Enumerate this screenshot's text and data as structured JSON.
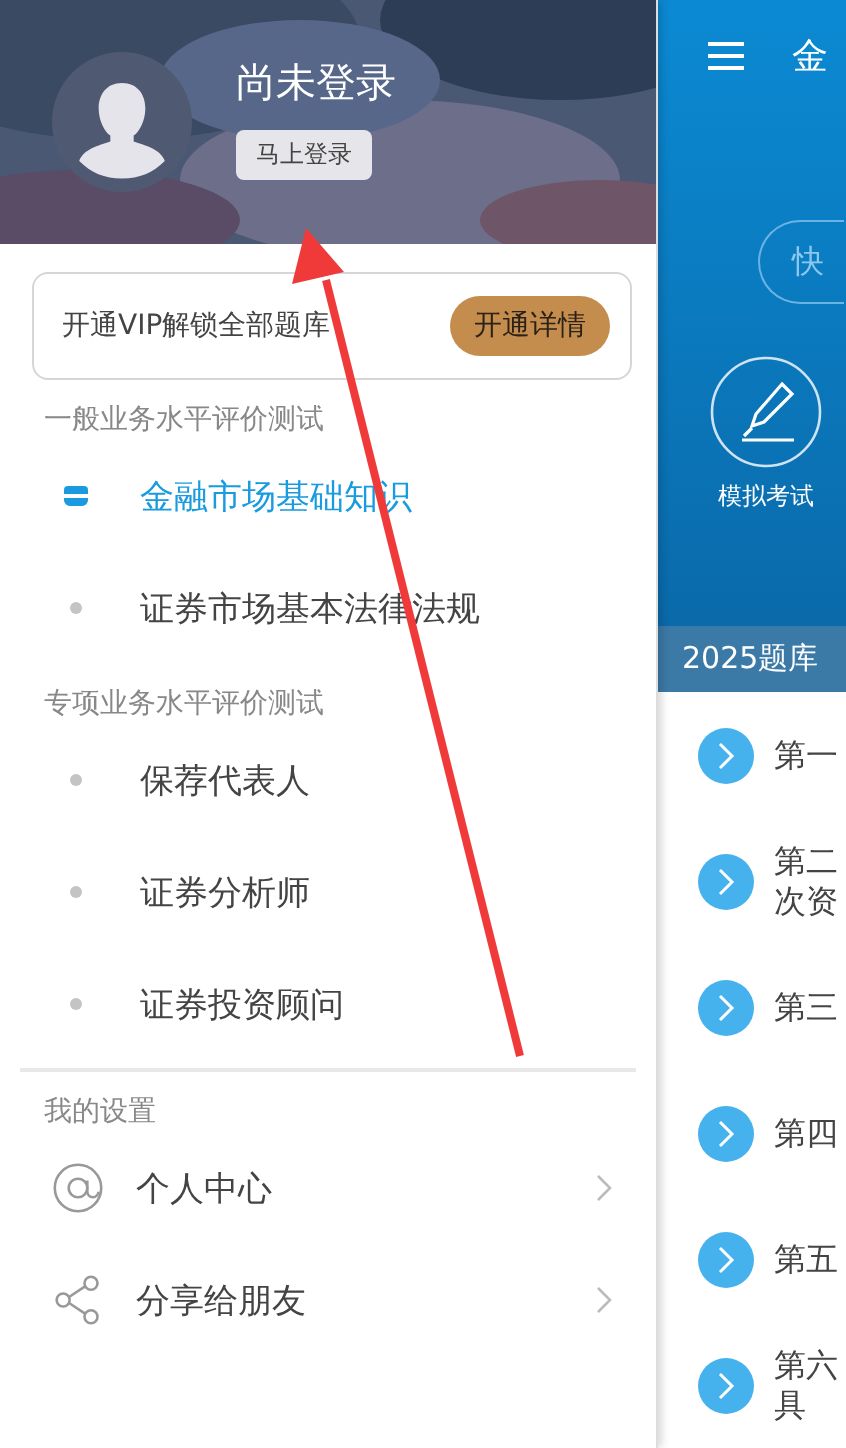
{
  "drawer": {
    "header": {
      "title": "尚未登录",
      "login_button": "马上登录"
    },
    "vip_banner": {
      "text": "开通VIP解锁全部题库",
      "button": "开通详情"
    },
    "sections": [
      {
        "title": "一般业务水平评价测试",
        "items": [
          {
            "label": "金融市场基础知识",
            "selected": true
          },
          {
            "label": "证券市场基本法律法规",
            "selected": false
          }
        ]
      },
      {
        "title": "专项业务水平评价测试",
        "items": [
          {
            "label": "保荐代表人",
            "selected": false
          },
          {
            "label": "证券分析师",
            "selected": false
          },
          {
            "label": "证券投资顾问",
            "selected": false
          }
        ]
      }
    ],
    "settings": {
      "title": "我的设置",
      "items": [
        {
          "label": "个人中心",
          "kind": "at"
        },
        {
          "label": "分享给朋友",
          "kind": "share"
        }
      ]
    }
  },
  "main": {
    "title": "金",
    "quick_button": "快",
    "exam_button": "模拟考试",
    "bank_title": "2025题库",
    "chapters": [
      {
        "lines": [
          "第一"
        ]
      },
      {
        "lines": [
          "第二",
          "次资"
        ]
      },
      {
        "lines": [
          "第三"
        ]
      },
      {
        "lines": [
          "第四"
        ]
      },
      {
        "lines": [
          "第五"
        ]
      },
      {
        "lines": [
          "第六",
          "具"
        ]
      }
    ]
  }
}
